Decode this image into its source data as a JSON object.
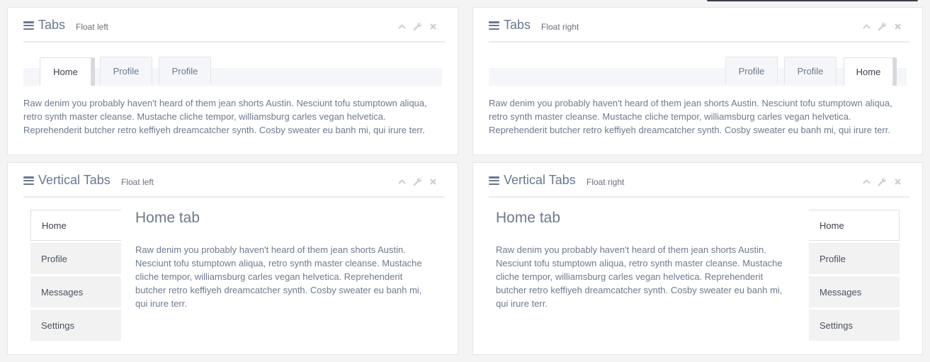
{
  "colors": {
    "page_background": "#f4f4f5",
    "panel_background": "#ffffff",
    "title_text": "#687892",
    "body_text": "#6d7a8e",
    "active_tab_background": "#ffffff",
    "inactive_tab_background": "#f4f6f9"
  },
  "widget_controls": {
    "collapse_icon": "chevron-up-icon",
    "settings_icon": "wrench-icon",
    "close_icon": "close-icon"
  },
  "panels": [
    {
      "title": "Tabs",
      "subtitle": "Float left",
      "tabs": [
        "Home",
        "Profile",
        "Profile"
      ],
      "active_tab": "Home",
      "content": "Raw denim you probably haven't heard of them jean shorts Austin. Nesciunt tofu stumptown aliqua, retro synth master cleanse. Mustache cliche tempor, williamsburg carles vegan helvetica. Reprehenderit butcher retro keffiyeh dreamcatcher synth. Cosby sweater eu banh mi, qui irure terr."
    },
    {
      "title": "Tabs",
      "subtitle": "Float right",
      "tabs": [
        "Profile",
        "Profile",
        "Home"
      ],
      "active_tab": "Home",
      "content": "Raw denim you probably haven't heard of them jean shorts Austin. Nesciunt tofu stumptown aliqua, retro synth master cleanse. Mustache cliche tempor, williamsburg carles vegan helvetica. Reprehenderit butcher retro keffiyeh dreamcatcher synth. Cosby sweater eu banh mi, qui irure terr."
    },
    {
      "title": "Vertical Tabs",
      "subtitle": "Float left",
      "tabs": [
        "Home",
        "Profile",
        "Messages",
        "Settings"
      ],
      "active_tab": "Home",
      "content_heading": "Home tab",
      "content": "Raw denim you probably haven't heard of them jean shorts Austin. Nesciunt tofu stumptown aliqua, retro synth master cleanse. Mustache cliche tempor, williamsburg carles vegan helvetica. Reprehenderit butcher retro keffiyeh dreamcatcher synth. Cosby sweater eu banh mi, qui irure terr."
    },
    {
      "title": "Vertical Tabs",
      "subtitle": "Float right",
      "tabs": [
        "Home",
        "Profile",
        "Messages",
        "Settings"
      ],
      "active_tab": "Home",
      "content_heading": "Home tab",
      "content": "Raw denim you probably haven't heard of them jean shorts Austin. Nesciunt tofu stumptown aliqua, retro synth master cleanse. Mustache cliche tempor, williamsburg carles vegan helvetica. Reprehenderit butcher retro keffiyeh dreamcatcher synth. Cosby sweater eu banh mi, qui irure terr."
    }
  ]
}
